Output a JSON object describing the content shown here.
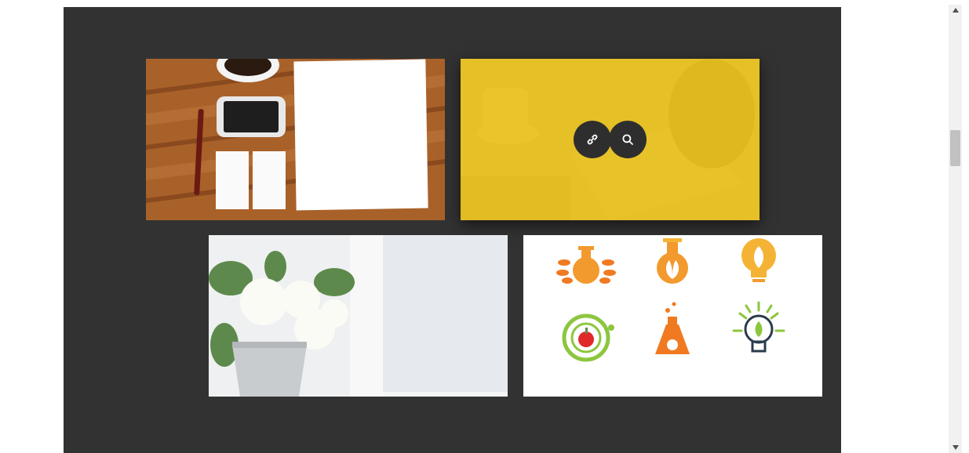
{
  "gallery": {
    "items": [
      {
        "name": "stationery-mockup",
        "hovered": false
      },
      {
        "name": "workspace-photo",
        "hovered": true
      },
      {
        "name": "white-roses-bucket",
        "hovered": false
      },
      {
        "name": "science-logos",
        "hovered": false
      }
    ],
    "overlay_color": "#e8be14",
    "hover_actions": {
      "link_icon": "link-icon",
      "zoom_icon": "search-icon"
    }
  },
  "colors": {
    "background": "#323232",
    "page": "#ffffff",
    "button": "#2e2e2e"
  }
}
